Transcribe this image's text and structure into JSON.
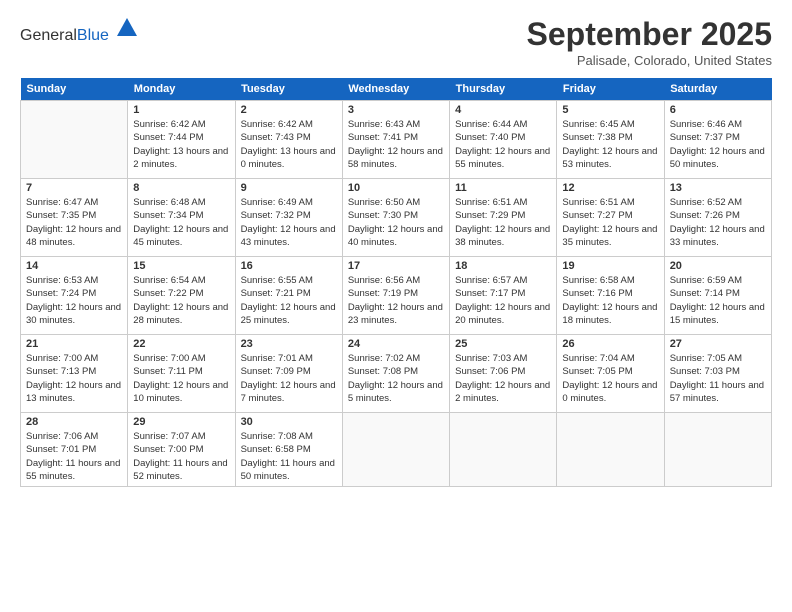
{
  "header": {
    "logo_general": "General",
    "logo_blue": "Blue",
    "month_title": "September 2025",
    "location": "Palisade, Colorado, United States"
  },
  "days_of_week": [
    "Sunday",
    "Monday",
    "Tuesday",
    "Wednesday",
    "Thursday",
    "Friday",
    "Saturday"
  ],
  "weeks": [
    [
      {
        "num": "",
        "sunrise": "",
        "sunset": "",
        "daylight": ""
      },
      {
        "num": "1",
        "sunrise": "Sunrise: 6:42 AM",
        "sunset": "Sunset: 7:44 PM",
        "daylight": "Daylight: 13 hours and 2 minutes."
      },
      {
        "num": "2",
        "sunrise": "Sunrise: 6:42 AM",
        "sunset": "Sunset: 7:43 PM",
        "daylight": "Daylight: 13 hours and 0 minutes."
      },
      {
        "num": "3",
        "sunrise": "Sunrise: 6:43 AM",
        "sunset": "Sunset: 7:41 PM",
        "daylight": "Daylight: 12 hours and 58 minutes."
      },
      {
        "num": "4",
        "sunrise": "Sunrise: 6:44 AM",
        "sunset": "Sunset: 7:40 PM",
        "daylight": "Daylight: 12 hours and 55 minutes."
      },
      {
        "num": "5",
        "sunrise": "Sunrise: 6:45 AM",
        "sunset": "Sunset: 7:38 PM",
        "daylight": "Daylight: 12 hours and 53 minutes."
      },
      {
        "num": "6",
        "sunrise": "Sunrise: 6:46 AM",
        "sunset": "Sunset: 7:37 PM",
        "daylight": "Daylight: 12 hours and 50 minutes."
      }
    ],
    [
      {
        "num": "7",
        "sunrise": "Sunrise: 6:47 AM",
        "sunset": "Sunset: 7:35 PM",
        "daylight": "Daylight: 12 hours and 48 minutes."
      },
      {
        "num": "8",
        "sunrise": "Sunrise: 6:48 AM",
        "sunset": "Sunset: 7:34 PM",
        "daylight": "Daylight: 12 hours and 45 minutes."
      },
      {
        "num": "9",
        "sunrise": "Sunrise: 6:49 AM",
        "sunset": "Sunset: 7:32 PM",
        "daylight": "Daylight: 12 hours and 43 minutes."
      },
      {
        "num": "10",
        "sunrise": "Sunrise: 6:50 AM",
        "sunset": "Sunset: 7:30 PM",
        "daylight": "Daylight: 12 hours and 40 minutes."
      },
      {
        "num": "11",
        "sunrise": "Sunrise: 6:51 AM",
        "sunset": "Sunset: 7:29 PM",
        "daylight": "Daylight: 12 hours and 38 minutes."
      },
      {
        "num": "12",
        "sunrise": "Sunrise: 6:51 AM",
        "sunset": "Sunset: 7:27 PM",
        "daylight": "Daylight: 12 hours and 35 minutes."
      },
      {
        "num": "13",
        "sunrise": "Sunrise: 6:52 AM",
        "sunset": "Sunset: 7:26 PM",
        "daylight": "Daylight: 12 hours and 33 minutes."
      }
    ],
    [
      {
        "num": "14",
        "sunrise": "Sunrise: 6:53 AM",
        "sunset": "Sunset: 7:24 PM",
        "daylight": "Daylight: 12 hours and 30 minutes."
      },
      {
        "num": "15",
        "sunrise": "Sunrise: 6:54 AM",
        "sunset": "Sunset: 7:22 PM",
        "daylight": "Daylight: 12 hours and 28 minutes."
      },
      {
        "num": "16",
        "sunrise": "Sunrise: 6:55 AM",
        "sunset": "Sunset: 7:21 PM",
        "daylight": "Daylight: 12 hours and 25 minutes."
      },
      {
        "num": "17",
        "sunrise": "Sunrise: 6:56 AM",
        "sunset": "Sunset: 7:19 PM",
        "daylight": "Daylight: 12 hours and 23 minutes."
      },
      {
        "num": "18",
        "sunrise": "Sunrise: 6:57 AM",
        "sunset": "Sunset: 7:17 PM",
        "daylight": "Daylight: 12 hours and 20 minutes."
      },
      {
        "num": "19",
        "sunrise": "Sunrise: 6:58 AM",
        "sunset": "Sunset: 7:16 PM",
        "daylight": "Daylight: 12 hours and 18 minutes."
      },
      {
        "num": "20",
        "sunrise": "Sunrise: 6:59 AM",
        "sunset": "Sunset: 7:14 PM",
        "daylight": "Daylight: 12 hours and 15 minutes."
      }
    ],
    [
      {
        "num": "21",
        "sunrise": "Sunrise: 7:00 AM",
        "sunset": "Sunset: 7:13 PM",
        "daylight": "Daylight: 12 hours and 13 minutes."
      },
      {
        "num": "22",
        "sunrise": "Sunrise: 7:00 AM",
        "sunset": "Sunset: 7:11 PM",
        "daylight": "Daylight: 12 hours and 10 minutes."
      },
      {
        "num": "23",
        "sunrise": "Sunrise: 7:01 AM",
        "sunset": "Sunset: 7:09 PM",
        "daylight": "Daylight: 12 hours and 7 minutes."
      },
      {
        "num": "24",
        "sunrise": "Sunrise: 7:02 AM",
        "sunset": "Sunset: 7:08 PM",
        "daylight": "Daylight: 12 hours and 5 minutes."
      },
      {
        "num": "25",
        "sunrise": "Sunrise: 7:03 AM",
        "sunset": "Sunset: 7:06 PM",
        "daylight": "Daylight: 12 hours and 2 minutes."
      },
      {
        "num": "26",
        "sunrise": "Sunrise: 7:04 AM",
        "sunset": "Sunset: 7:05 PM",
        "daylight": "Daylight: 12 hours and 0 minutes."
      },
      {
        "num": "27",
        "sunrise": "Sunrise: 7:05 AM",
        "sunset": "Sunset: 7:03 PM",
        "daylight": "Daylight: 11 hours and 57 minutes."
      }
    ],
    [
      {
        "num": "28",
        "sunrise": "Sunrise: 7:06 AM",
        "sunset": "Sunset: 7:01 PM",
        "daylight": "Daylight: 11 hours and 55 minutes."
      },
      {
        "num": "29",
        "sunrise": "Sunrise: 7:07 AM",
        "sunset": "Sunset: 7:00 PM",
        "daylight": "Daylight: 11 hours and 52 minutes."
      },
      {
        "num": "30",
        "sunrise": "Sunrise: 7:08 AM",
        "sunset": "Sunset: 6:58 PM",
        "daylight": "Daylight: 11 hours and 50 minutes."
      },
      {
        "num": "",
        "sunrise": "",
        "sunset": "",
        "daylight": ""
      },
      {
        "num": "",
        "sunrise": "",
        "sunset": "",
        "daylight": ""
      },
      {
        "num": "",
        "sunrise": "",
        "sunset": "",
        "daylight": ""
      },
      {
        "num": "",
        "sunrise": "",
        "sunset": "",
        "daylight": ""
      }
    ]
  ]
}
